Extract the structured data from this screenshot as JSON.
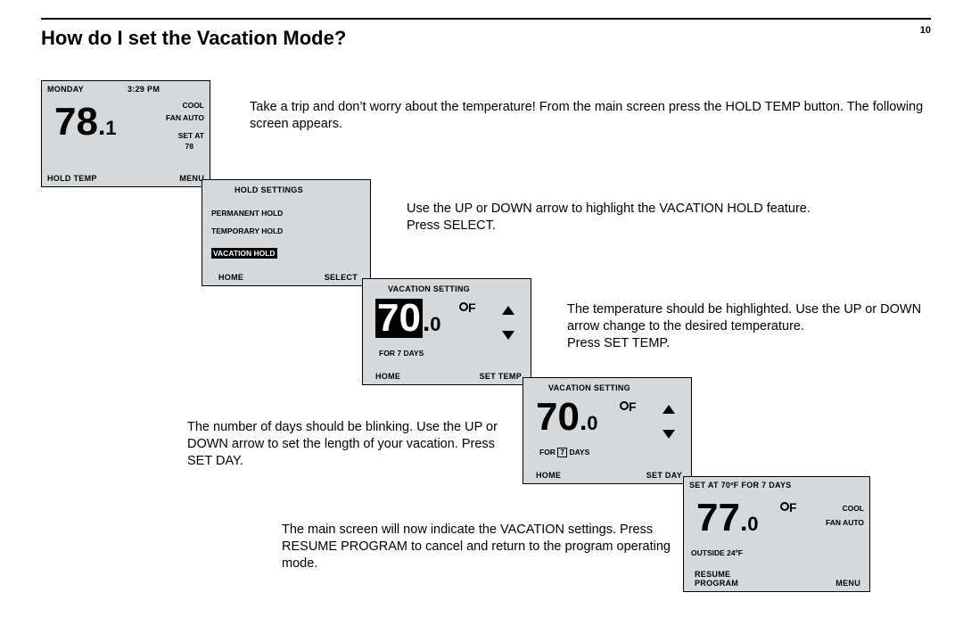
{
  "page_number": "10",
  "title": "How do I set the Vacation Mode?",
  "para1": "Take a trip and don’t worry about the temperature! From the main screen press the HOLD TEMP button. The following screen appears.",
  "para2a": "Use the UP or DOWN arrow to highlight the VACATION HOLD feature.",
  "para2b": "Press SELECT.",
  "para3a": "The temperature should be highlighted. Use the UP or DOWN arrow change to the desired temperature.",
  "para3b": "Press SET TEMP.",
  "para4a": "The number of days should be blinking. Use the UP or DOWN arrow to set the length of your vacation. Press SET DAY.",
  "para5a": "The main screen will now indicate the VACATION settings. Press RESUME PROGRAM to cancel and return to the program operating mode.",
  "lcd1": {
    "day": "MONDAY",
    "time": "3:29 PM",
    "mode": "COOL",
    "fan": "FAN AUTO",
    "setat_lbl": "SET AT",
    "setat_val": "78",
    "temp_whole": "78",
    "temp_tenth": "1",
    "btn_left": "HOLD TEMP",
    "btn_right": "MENU"
  },
  "lcd2": {
    "title": "HOLD SETTINGS",
    "opt1": "PERMANENT HOLD",
    "opt2": "TEMPORARY HOLD",
    "opt3": "VACATION HOLD",
    "btn_left": "HOME",
    "btn_right": "SELECT"
  },
  "lcd3": {
    "title": "VACATION SETTING",
    "temp_whole": "70",
    "temp_tenth": "0",
    "duration_pre": "FOR",
    "duration_days": "7",
    "duration_post": "DAYS",
    "btn_left": "HOME",
    "btn_right": "SET TEMP"
  },
  "lcd4": {
    "title": "VACATION SETTING",
    "temp_whole": "70",
    "temp_tenth": "0",
    "duration_pre": "FOR",
    "duration_days": "7",
    "duration_post": "DAYS",
    "btn_left": "HOME",
    "btn_right": "SET DAY"
  },
  "lcd5": {
    "title": "SET AT 70ºF FOR 7 DAYS",
    "temp_whole": "77",
    "temp_tenth": "0",
    "mode": "COOL",
    "fan": "FAN AUTO",
    "outside": "OUTSIDE 24ºF",
    "btn_left1": "RESUME",
    "btn_left2": "PROGRAM",
    "btn_right": "MENU"
  }
}
